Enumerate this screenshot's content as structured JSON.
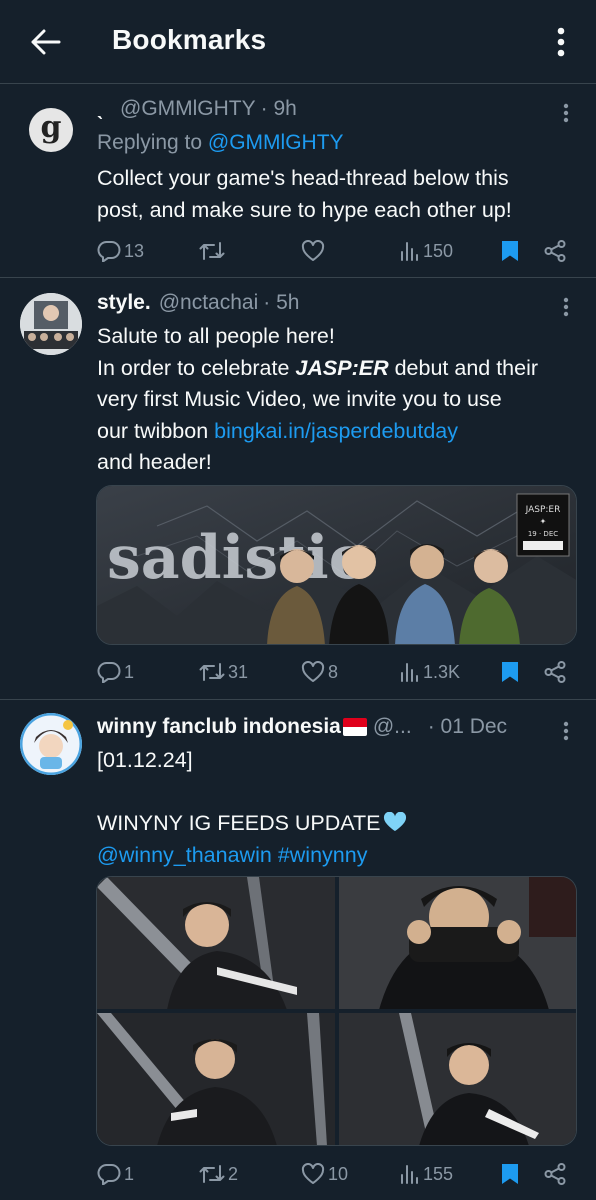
{
  "header": {
    "title": "Bookmarks"
  },
  "tweets": [
    {
      "avatar_letter": "g",
      "name": "ˎ",
      "handle": "@GMMlGHTY",
      "time": "· 9h",
      "replying_prefix": "Replying to",
      "replying_to": "@GMMlGHTY",
      "body_line1": "Collect your game's head-thread below this",
      "body_line2": "post, and make sure to hype each other up!",
      "replies": "13",
      "retweets": "",
      "likes": "",
      "views": "150"
    },
    {
      "name": "style.",
      "handle": "@nctachai",
      "time": "· 5h",
      "body_line1": "Salute to all people here!",
      "body_line2_pre": "In order to celebrate ",
      "body_line2_bold": "JASP:ER",
      "body_line2_post": " debut and their",
      "body_line3": "very first Music Video, we invite you to use",
      "body_line4_pre": "our twibbon ",
      "body_line4_link": "bingkai.in/jasperdebutday",
      "body_line5": "and header!",
      "banner_text": "sadistic",
      "banner_tag_line1": "JASP:ER",
      "banner_tag_line2": "✦",
      "banner_tag_line3": "19 · DEC",
      "replies": "1",
      "retweets": "31",
      "likes": "8",
      "views": "1.3K"
    },
    {
      "name": "winny fanclub indonesia",
      "flag": "id-flag",
      "handle": "@...",
      "time": "· 01 Dec",
      "body_line1": "[01.12.24]",
      "body_line2": "WINYNY IG FEEDS UPDATE",
      "body_line2_emoji": "🩵",
      "link1": "@winny_thanawin",
      "link2": "#winynny",
      "replies": "1",
      "retweets": "2",
      "likes": "10",
      "views": "155"
    }
  ],
  "colors": {
    "background": "#15202b",
    "border": "#38444d",
    "text": "#f7f9f9",
    "muted": "#8b98a5",
    "accent": "#1d9bf0"
  },
  "icons": {
    "back": "arrow-left-icon",
    "more": "more-vertical-icon",
    "reply": "reply-icon",
    "retweet": "retweet-icon",
    "like": "heart-icon",
    "views": "views-icon",
    "bookmark": "bookmark-filled-icon",
    "share": "share-icon"
  }
}
